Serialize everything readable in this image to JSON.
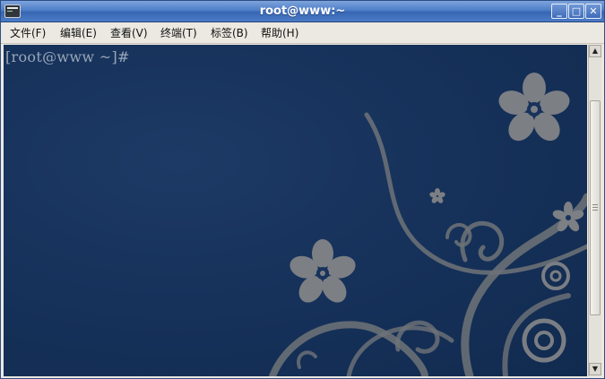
{
  "window": {
    "title": "root@www:~",
    "controls": {
      "minimize": "_",
      "maximize": "□",
      "close": "✕"
    },
    "icon": "terminal-icon"
  },
  "menu": {
    "items": [
      {
        "label": "文件(F)"
      },
      {
        "label": "编辑(E)"
      },
      {
        "label": "查看(V)"
      },
      {
        "label": "终端(T)"
      },
      {
        "label": "标签(B)"
      },
      {
        "label": "帮助(H)"
      }
    ]
  },
  "terminal": {
    "prompt": "[root@www ~]#",
    "background_color": "#17335c",
    "text_color": "#9aa7b8"
  },
  "scrollbar": {
    "up_arrow": "▲",
    "down_arrow": "▼"
  }
}
